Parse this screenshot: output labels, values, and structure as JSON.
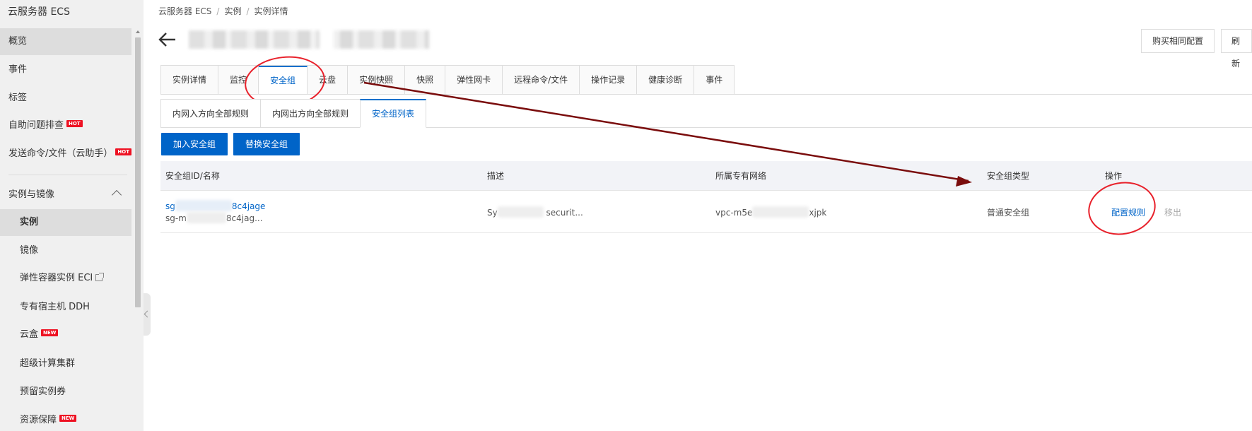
{
  "sidebar": {
    "title": "云服务器 ECS",
    "items": [
      {
        "label": "概览"
      },
      {
        "label": "事件"
      },
      {
        "label": "标签"
      },
      {
        "label": "自助问题排查",
        "badge": "HOT"
      },
      {
        "label": "发送命令/文件（云助手）",
        "badge": "HOT"
      }
    ],
    "group": "实例与镜像",
    "sub_items": [
      {
        "label": "实例"
      },
      {
        "label": "镜像"
      },
      {
        "label": "弹性容器实例 ECI"
      },
      {
        "label": "专有宿主机 DDH"
      },
      {
        "label": "云盒",
        "badge": "NEW"
      },
      {
        "label": "超级计算集群"
      },
      {
        "label": "预留实例券"
      },
      {
        "label": "资源保障",
        "badge": "NEW"
      }
    ]
  },
  "breadcrumb": [
    "云服务器 ECS",
    "实例",
    "实例详情"
  ],
  "header": {
    "buy_same_label": "购买相同配置",
    "refresh_label": "刷新"
  },
  "tabs": [
    {
      "label": "实例详情"
    },
    {
      "label": "监控"
    },
    {
      "label": "安全组",
      "active": true
    },
    {
      "label": "云盘"
    },
    {
      "label": "实例快照"
    },
    {
      "label": "快照"
    },
    {
      "label": "弹性网卡"
    },
    {
      "label": "远程命令/文件"
    },
    {
      "label": "操作记录"
    },
    {
      "label": "健康诊断"
    },
    {
      "label": "事件"
    }
  ],
  "sub_tabs": [
    {
      "label": "内网入方向全部规则"
    },
    {
      "label": "内网出方向全部规则"
    },
    {
      "label": "安全组列表",
      "active": true
    }
  ],
  "actions": {
    "join_label": "加入安全组",
    "replace_label": "替换安全组"
  },
  "table": {
    "columns": [
      "安全组ID/名称",
      "描述",
      "所属专有网络",
      "安全组类型",
      "操作"
    ],
    "rows": [
      {
        "id_prefix": "sg",
        "id_suffix": "8c4jage",
        "name_prefix": "sg-m",
        "name_suffix": "8c4jag...",
        "desc_prefix": "Sy",
        "desc_suffix": "securit...",
        "vpc_prefix": "vpc-m5e",
        "vpc_suffix": "xjpk",
        "type": "普通安全组",
        "op_config": "配置规则",
        "op_remove": "移出"
      }
    ]
  },
  "colors": {
    "primary": "#0064c8",
    "annotation": "#e8212b",
    "arrow": "#7a0c0c",
    "hot_badge": "#ee1122"
  }
}
